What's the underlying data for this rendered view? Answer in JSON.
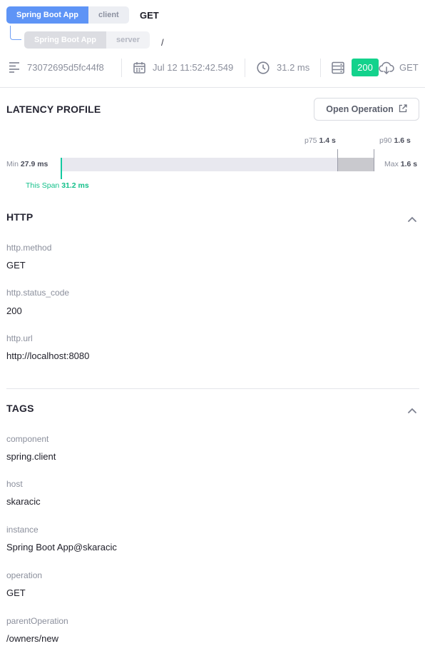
{
  "header": {
    "client_chip": {
      "service": "Spring Boot App",
      "kind": "client"
    },
    "server_chip": {
      "service": "Spring Boot App",
      "kind": "server"
    },
    "method": "GET",
    "path": "/"
  },
  "meta": {
    "trace_id": "73072695d5fc44f8",
    "timestamp": "Jul 12 11:52:42.549",
    "duration": "31.2 ms",
    "status_code": "200",
    "method": "GET",
    "icons": [
      "align-left-icon",
      "calendar-icon",
      "clock-icon",
      "server-icon",
      "cloud-download-icon"
    ]
  },
  "latency": {
    "title": "LATENCY PROFILE",
    "open_button": "Open Operation",
    "p75_label": "p75",
    "p75_value": "1.4 s",
    "p90_label": "p90",
    "p90_value": "1.6 s",
    "min_label": "Min",
    "min_value": "27.9 ms",
    "max_label": "Max",
    "max_value": "1.6 s",
    "span_label": "This Span",
    "span_value": "31.2 ms"
  },
  "http": {
    "title": "HTTP",
    "attributes": [
      {
        "key": "http.method",
        "value": "GET"
      },
      {
        "key": "http.status_code",
        "value": "200"
      },
      {
        "key": "http.url",
        "value": "http://localhost:8080"
      }
    ]
  },
  "tags": {
    "title": "TAGS",
    "attributes": [
      {
        "key": "component",
        "value": "spring.client"
      },
      {
        "key": "host",
        "value": "skaracic"
      },
      {
        "key": "instance",
        "value": "Spring Boot App@skaracic"
      },
      {
        "key": "operation",
        "value": "GET"
      },
      {
        "key": "parentOperation",
        "value": "/owners/new"
      }
    ]
  },
  "colors": {
    "accent_blue": "#5e94f6",
    "status_green": "#13d28c",
    "span_teal": "#13c08a"
  }
}
